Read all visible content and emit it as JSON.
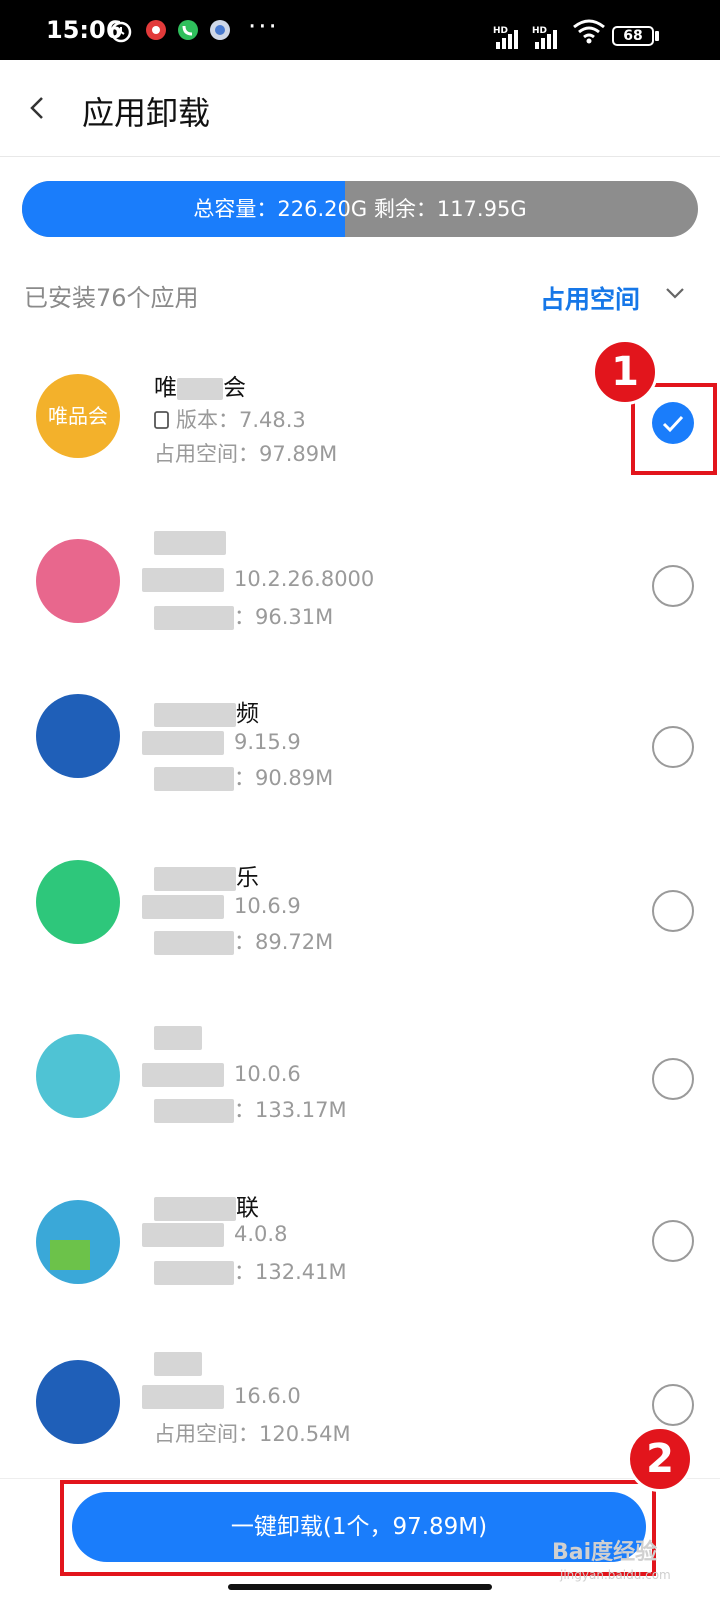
{
  "status_bar": {
    "time": "15:06",
    "battery": "68",
    "network_labels": [
      "HD",
      "HD"
    ],
    "overflow": "···"
  },
  "header": {
    "title": "应用卸载"
  },
  "storage": {
    "text": "总容量：226.20G  剩余：117.95G",
    "used_fraction": 0.478
  },
  "list_header": {
    "installed_count": "已安装76个应用",
    "sort_label": "占用空间"
  },
  "apps": [
    {
      "name_prefix": "唯",
      "name_suffix": "会",
      "icon_text": "唯品会",
      "icon_color": "#f3b12b",
      "version_label": "版本：",
      "version": "7.48.3",
      "size_label": "占用空间：",
      "size": "97.89M",
      "checked": true
    },
    {
      "name_suffix": "",
      "version": "10.2.26.8000",
      "size": "96.31M",
      "icon_color": "#e8678d",
      "checked": false
    },
    {
      "name_suffix": "频",
      "version": "9.15.9",
      "size": "90.89M",
      "icon_color": "#1f5fb8",
      "checked": false
    },
    {
      "name_suffix": "乐",
      "version": "10.6.9",
      "size": "89.72M",
      "icon_color": "#2ec77b",
      "checked": false
    },
    {
      "name_suffix": "",
      "version": "10.0.6",
      "size": "133.17M",
      "icon_color": "#4fc3d4",
      "checked": false
    },
    {
      "name_suffix": "联",
      "version": "4.0.8",
      "size": "132.41M",
      "icon_color": "#3aa8d8",
      "checked": false
    },
    {
      "name_suffix": "",
      "version": "16.6.0",
      "size": "120.54M",
      "size_label": "占用空间：",
      "icon_color": "#1f5fb8",
      "checked": false
    }
  ],
  "annotations": {
    "step1": "1",
    "step2": "2"
  },
  "bottom": {
    "uninstall_label": "一键卸载(1个，97.89M)"
  },
  "watermark": {
    "text": "Bai度经验",
    "sub": "jingyan.baidu.com"
  },
  "colors": {
    "accent": "#1a7dfb",
    "annotation_red": "#e2151c",
    "remaining": "#8d8d8d"
  }
}
